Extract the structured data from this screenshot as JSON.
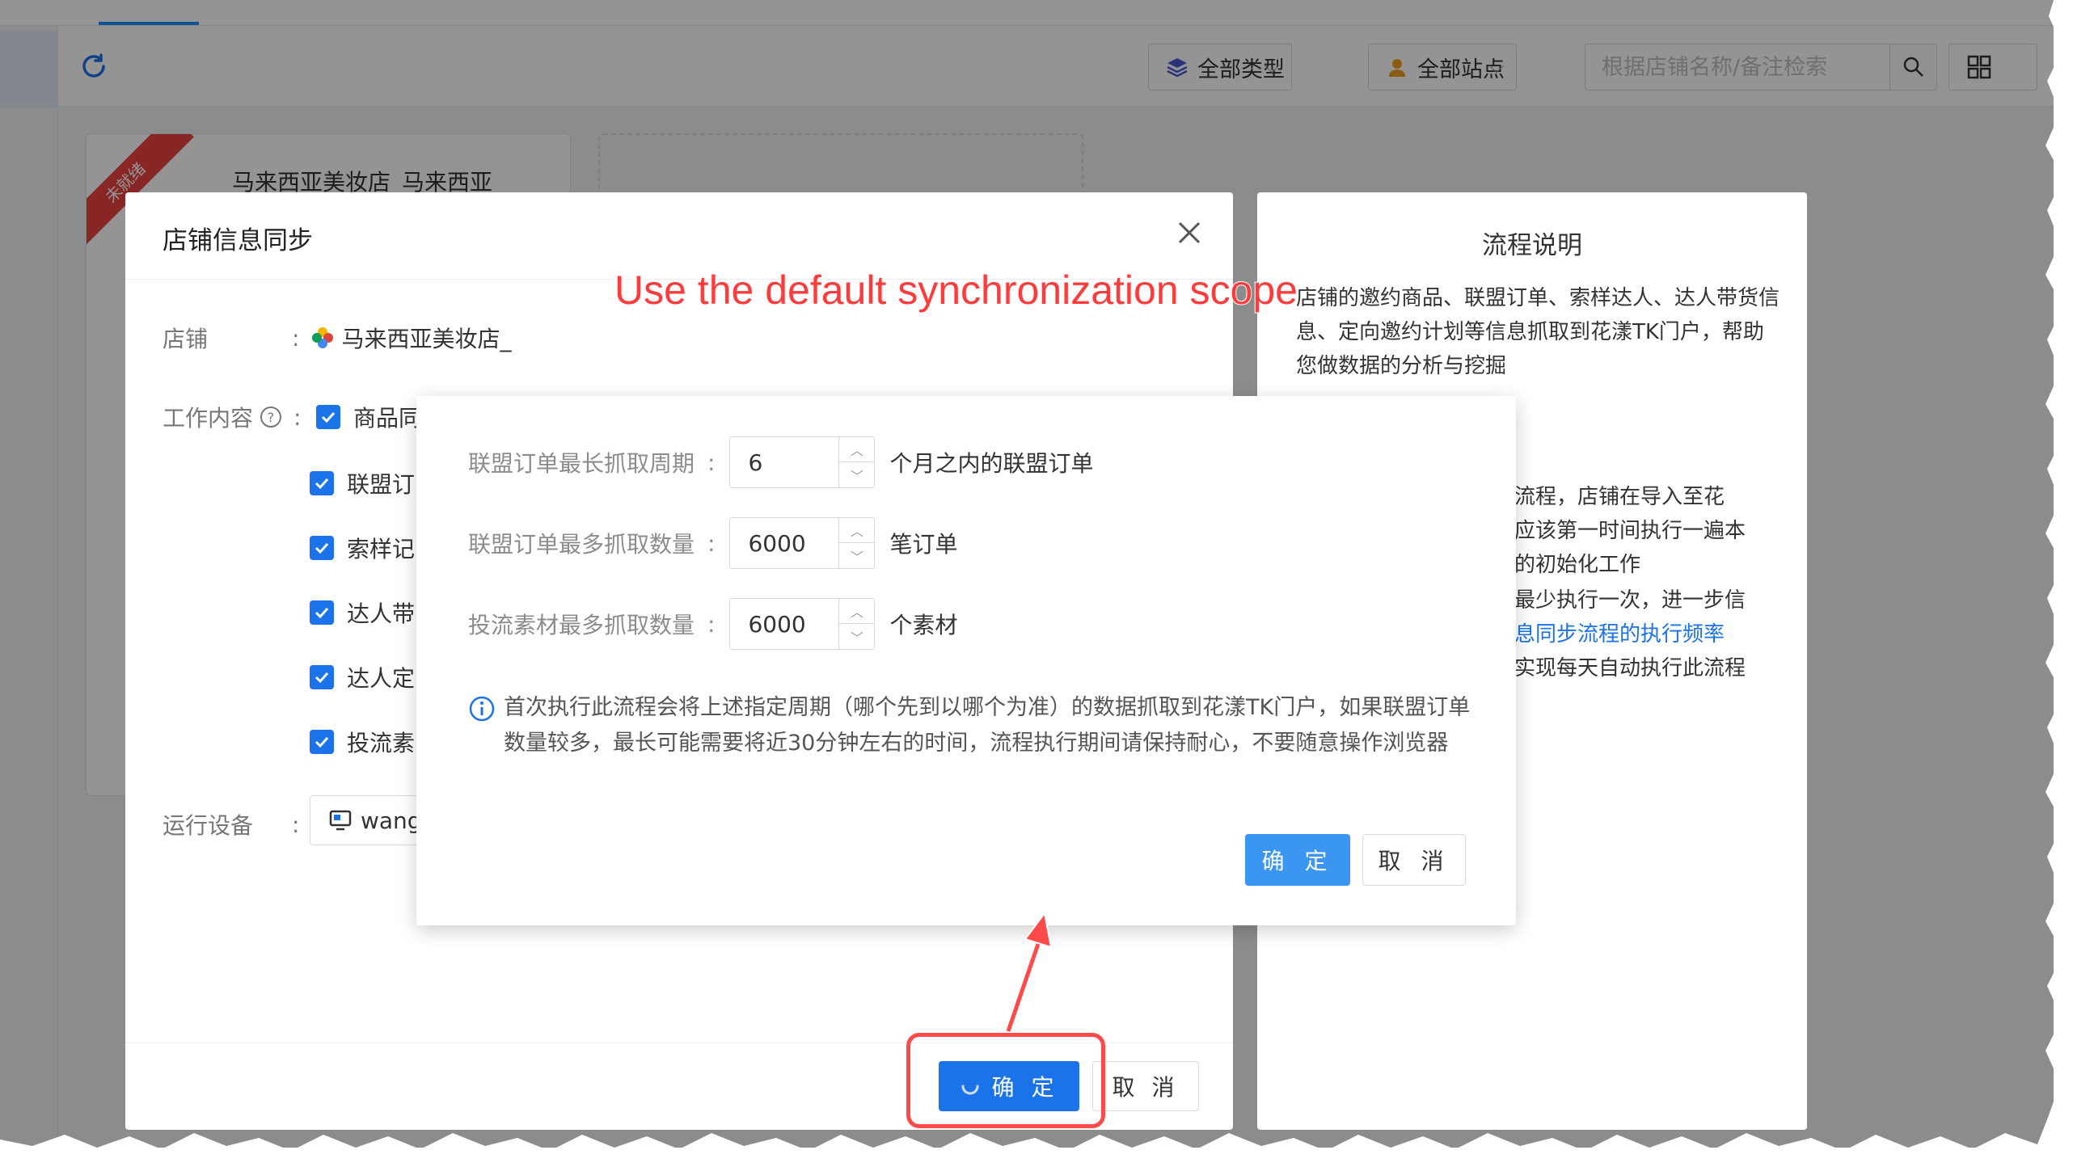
{
  "toolbar": {
    "type_select": "全部类型",
    "site_select": "全部站点",
    "search_placeholder": "根据店铺名称/备注检索"
  },
  "store_card": {
    "ribbon": "未就绪",
    "name": "马来西亚美妆店_马来西亚"
  },
  "main_dialog": {
    "title": "店铺信息同步",
    "shop_label": "店铺",
    "shop_value": "马来西亚美妆店_",
    "work_label": "工作内容",
    "work_items": [
      "商品同",
      "联盟订",
      "索样记",
      "达人带",
      "达人定",
      "投流素"
    ],
    "device_label": "运行设备",
    "device_value": "wang",
    "confirm_label": "确 定",
    "cancel_label": "取 消"
  },
  "process_panel": {
    "title": "流程说明",
    "para1": "店铺的邀约商品、联盟订单、索样达人、达人带货信息、定向邀约计划等信息抓取到花漾TK门户，帮助您做数据的分析与挖掘",
    "para2_lines": [
      "流程，店铺在导入至花",
      "应该第一时间执行一遍本",
      "的初始化工作"
    ],
    "para3_line1": "最少执行一次，进一步信",
    "para3_link": "息同步流程的执行频率",
    "para3_line3": "实现每天自动执行此流程"
  },
  "sub_dialog": {
    "rows": [
      {
        "label": "联盟订单最长抓取周期",
        "value": "6",
        "suffix": "个月之内的联盟订单"
      },
      {
        "label": "联盟订单最多抓取数量",
        "value": "6000",
        "suffix": "笔订单"
      },
      {
        "label": "投流素材最多抓取数量",
        "value": "6000",
        "suffix": "个素材"
      }
    ],
    "notice": "首次执行此流程会将上述指定周期（哪个先到以哪个为准）的数据抓取到花漾TK门户，如果联盟订单数量较多，最长可能需要将近30分钟左右的时间，流程执行期间请保持耐心，不要随意操作浏览器",
    "ok_label": "确 定",
    "cancel_label": "取 消"
  },
  "annotation": {
    "text": "Use the default synchronization scope",
    "color": "#ff3b3b"
  },
  "colors": {
    "primary": "#1a73e8",
    "ok_button": "#3a96f0",
    "ribbon": "#e8423f"
  }
}
